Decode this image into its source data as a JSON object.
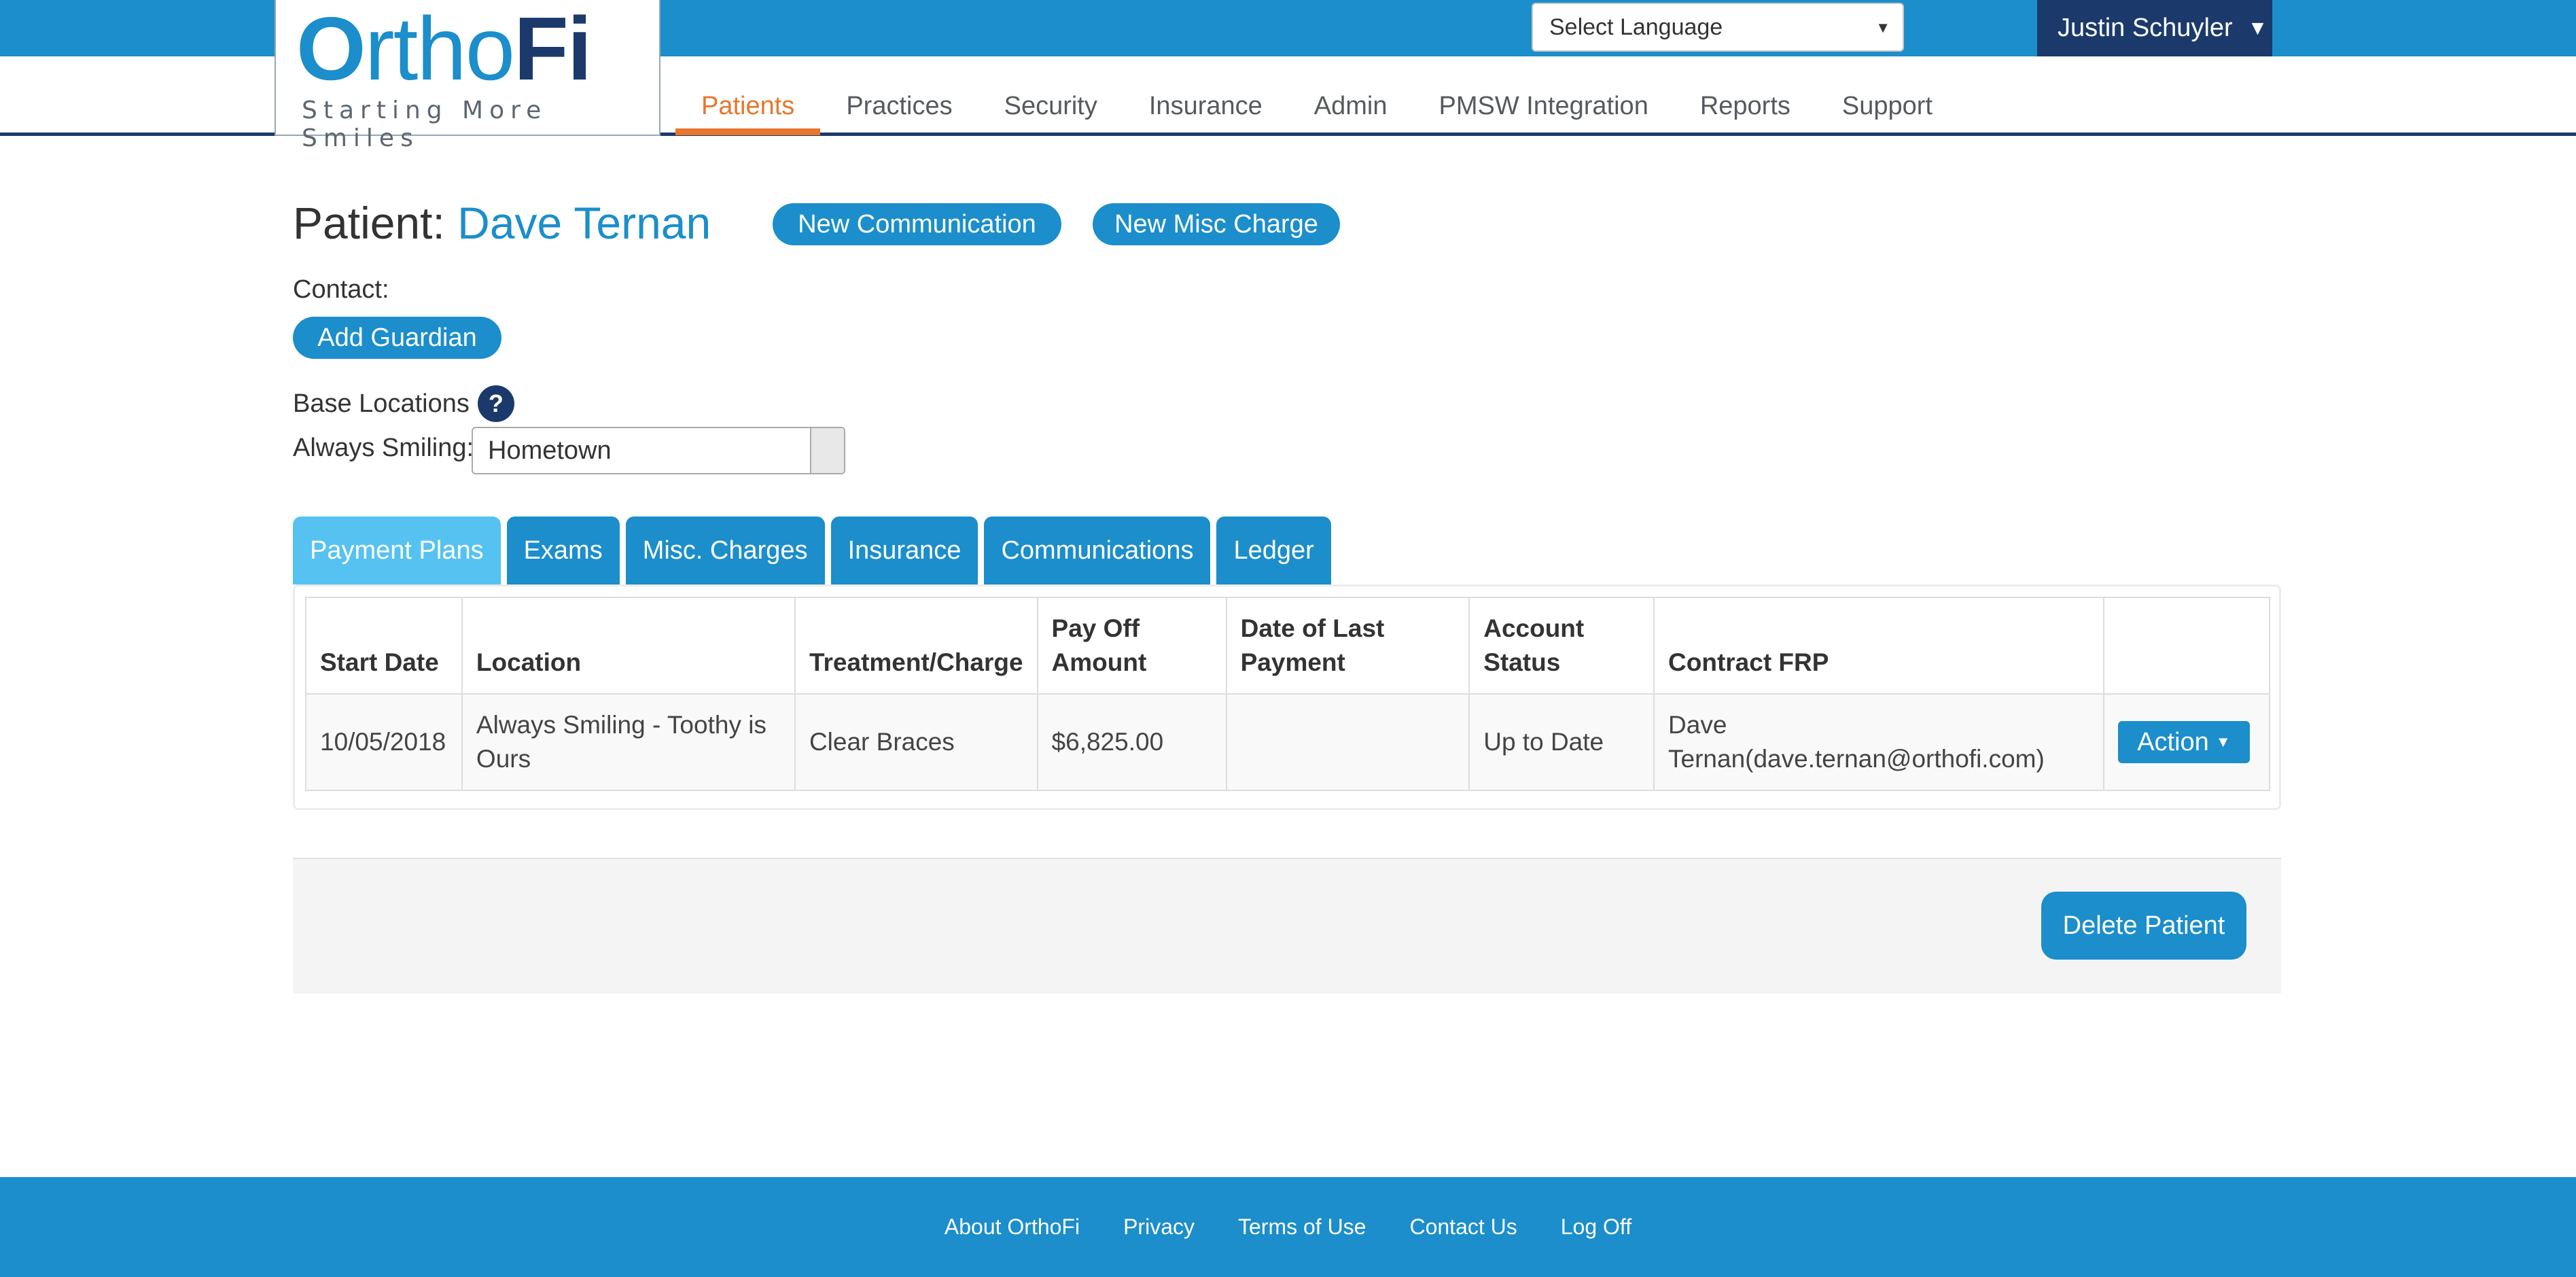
{
  "header": {
    "language_select": "Select Language",
    "user_name": "Justin Schuyler",
    "logo": {
      "part1": "O",
      "part2": "rtho",
      "part3": "Fi",
      "tagline": "Starting More Smiles"
    }
  },
  "nav": {
    "items": [
      {
        "label": "Patients",
        "active": true
      },
      {
        "label": "Practices"
      },
      {
        "label": "Security"
      },
      {
        "label": "Insurance"
      },
      {
        "label": "Admin"
      },
      {
        "label": "PMSW Integration"
      },
      {
        "label": "Reports"
      },
      {
        "label": "Support"
      }
    ]
  },
  "patient": {
    "title_prefix": "Patient:",
    "name": "Dave Ternan",
    "new_communication_label": "New Communication",
    "new_misc_charge_label": "New Misc Charge",
    "contact_label": "Contact:",
    "add_guardian_label": "Add Guardian",
    "base_locations_label": "Base Locations",
    "help_icon_glyph": "?",
    "always_smiling_label": "Always Smiling:",
    "location_value": "Hometown"
  },
  "tabs": [
    {
      "label": "Payment Plans",
      "active": true
    },
    {
      "label": "Exams"
    },
    {
      "label": "Misc. Charges"
    },
    {
      "label": "Insurance"
    },
    {
      "label": "Communications"
    },
    {
      "label": "Ledger"
    }
  ],
  "table": {
    "headers": [
      "Start Date",
      "Location",
      "Treatment/Charge",
      "Pay Off Amount",
      "Date of Last Payment",
      "Account Status",
      "Contract FRP",
      ""
    ],
    "rows": [
      {
        "start_date": "10/05/2018",
        "location": "Always Smiling - Toothy is Ours",
        "treatment": "Clear Braces",
        "payoff": "$6,825.00",
        "last_payment": "",
        "status": "Up to Date",
        "frp": "Dave Ternan(dave.ternan@orthofi.com)",
        "action_label": "Action"
      }
    ]
  },
  "delete_label": "Delete Patient",
  "footer": {
    "links": [
      "About OrthoFi",
      "Privacy",
      "Terms of Use",
      "Contact Us",
      "Log Off"
    ]
  },
  "colors": {
    "primary_blue": "#1b8ecb",
    "navy": "#1b3a6b",
    "active_orange": "#e8762c",
    "active_tab": "#56c2f1"
  }
}
